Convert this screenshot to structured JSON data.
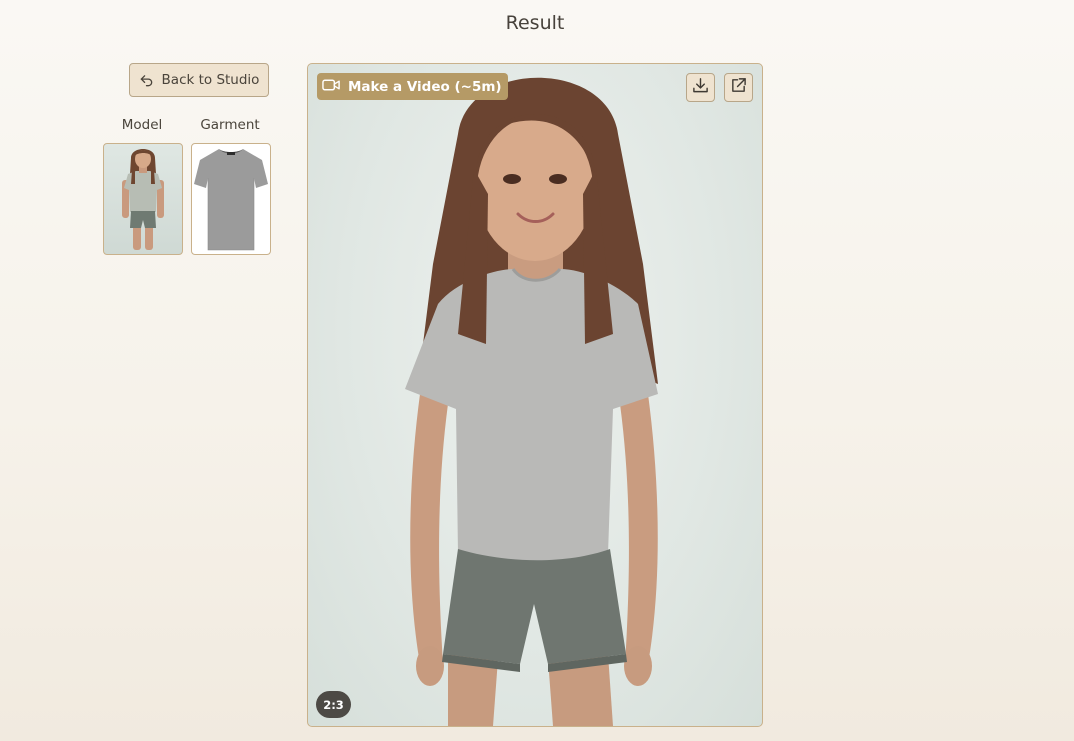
{
  "page": {
    "title": "Result"
  },
  "back_button": {
    "label": "Back to Studio",
    "icon": "undo-arrow-icon"
  },
  "inputs": {
    "model_label": "Model",
    "garment_label": "Garment"
  },
  "result": {
    "video_button_label": "Make a Video (~5m)",
    "video_icon": "video-camera-icon",
    "download_icon": "download-icon",
    "open_icon": "external-link-icon",
    "aspect_ratio": "2:3"
  },
  "colors": {
    "accent": "#b59a66",
    "button_bg": "#efe3d0",
    "border": "#c9b18b",
    "badge_bg": "#4d4a45"
  }
}
